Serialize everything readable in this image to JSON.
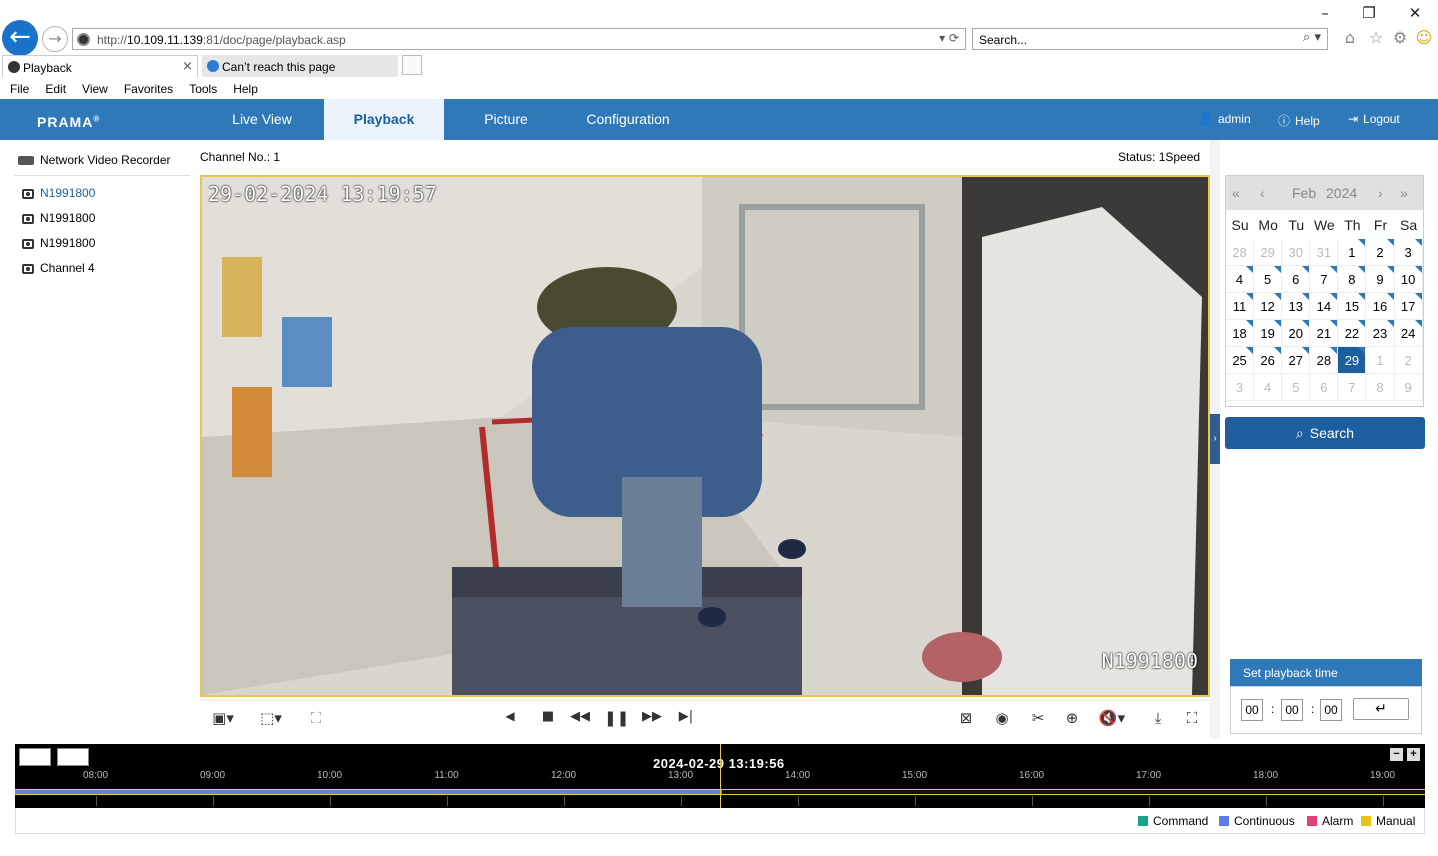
{
  "browser": {
    "url_prefix": "http://",
    "url_host": "10.109.11.139",
    "url_rest": ":81/doc/page/playback.asp",
    "search_placeholder": "Search...",
    "tabs": [
      {
        "label": "Playback",
        "close": "×"
      },
      {
        "label": "Can’t reach this page"
      }
    ],
    "menu": [
      "File",
      "Edit",
      "View",
      "Favorites",
      "Tools",
      "Help"
    ]
  },
  "app": {
    "logo": "PRAMA",
    "nav": [
      "Live View",
      "Playback",
      "Picture",
      "Configuration"
    ],
    "user": "admin",
    "help": "Help",
    "logout": "Logout"
  },
  "tree": {
    "root": "Network Video Recorder",
    "channels": [
      "N1991800",
      "N1991800",
      "N1991800",
      "Channel 4"
    ]
  },
  "player": {
    "channel_label": "Channel No.: 1",
    "status_label": "Status: 1Speed",
    "osd_time": "29-02-2024 13:19:57",
    "osd_name": "N1991800"
  },
  "calendar": {
    "month": "Feb",
    "year": "2024",
    "weekdays": [
      "Su",
      "Mo",
      "Tu",
      "We",
      "Th",
      "Fr",
      "Sa"
    ],
    "weeks": [
      [
        "28",
        "29",
        "30",
        "31",
        "1",
        "2",
        "3"
      ],
      [
        "4",
        "5",
        "6",
        "7",
        "8",
        "9",
        "10"
      ],
      [
        "11",
        "12",
        "13",
        "14",
        "15",
        "16",
        "17"
      ],
      [
        "18",
        "19",
        "20",
        "21",
        "22",
        "23",
        "24"
      ],
      [
        "25",
        "26",
        "27",
        "28",
        "29",
        "1",
        "2"
      ],
      [
        "3",
        "4",
        "5",
        "6",
        "7",
        "8",
        "9"
      ]
    ],
    "selected": "29",
    "search_label": "Search"
  },
  "playback_time": {
    "title": "Set playback time",
    "hh": "00",
    "mm": "00",
    "ss": "00"
  },
  "timeline": {
    "current": "2024-02-29 13:19:56",
    "ticks": [
      "08:00",
      "09:00",
      "10:00",
      "11:00",
      "12:00",
      "13:00",
      "14:00",
      "15:00",
      "16:00",
      "17:00",
      "18:00",
      "19:00"
    ],
    "recorded_fraction": 0.5
  },
  "legend": [
    {
      "label": "Command",
      "color": "#1aa389"
    },
    {
      "label": "Continuous",
      "color": "#5b7be8"
    },
    {
      "label": "Alarm",
      "color": "#e3407a"
    },
    {
      "label": "Manual",
      "color": "#e8c417"
    }
  ],
  "colors": {
    "nav": "#2f79b9",
    "accent": "#1d5f9e",
    "video_border": "#e7c84a"
  }
}
